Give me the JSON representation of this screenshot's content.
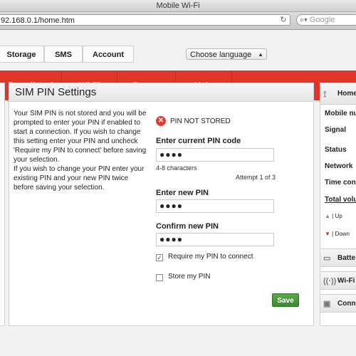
{
  "window": {
    "title": "Mobile Wi-Fi"
  },
  "browser": {
    "url": "92.168.0.1/home.htm",
    "search_placeholder": "Google"
  },
  "topnav": {
    "tabs": [
      "Storage",
      "SMS",
      "Account"
    ],
    "language": "Choose language"
  },
  "mainnav": {
    "tabs": [
      "Broadband",
      "Wi-Fi",
      "Router",
      "Help"
    ],
    "active": "Broadband",
    "color": "#e2352a"
  },
  "sim_pin": {
    "title": "SIM PIN Settings",
    "description": "Your SIM PIN is not stored and you will be prompted to enter your PIN if enabled to start a connection. If you wish to change this setting enter your PIN and uncheck 'Require my PIN to connect' before saving your selection.\nIf you wish to change your PIN enter your existing PIN and your new PIN twice before saving your selection.",
    "status": "PIN NOT STORED",
    "current_label": "Enter current PIN code",
    "current_value": "●●●●",
    "hint": "4-8 characters",
    "attempt": "Attempt 1 of 3",
    "new_label": "Enter new PIN",
    "new_value": "●●●●",
    "confirm_label": "Confirm new PIN",
    "confirm_value": "●●●●",
    "require_label": "Require my PIN to connect",
    "require_checked": true,
    "store_label": "Store my PIN",
    "store_checked": false,
    "save_label": "Save"
  },
  "sidebar": {
    "home": "Home",
    "rows": [
      "Mobile nu",
      "Signal",
      "Status",
      "Network",
      "Time conn"
    ],
    "total": "Total volu",
    "up": "Up",
    "down": "Down",
    "battery": "Batte",
    "wifi": "Wi-Fi",
    "connect": "Conn"
  }
}
